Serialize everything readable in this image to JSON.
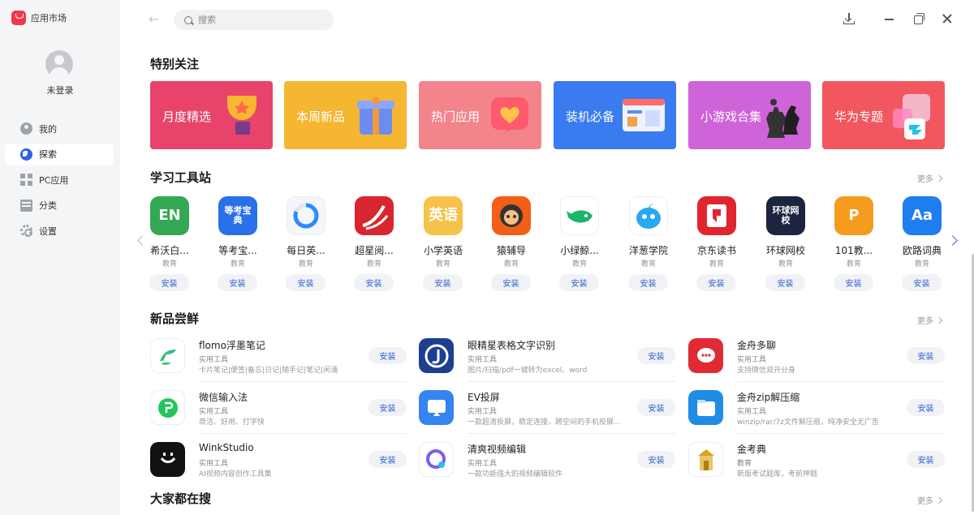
{
  "app": {
    "name": "应用市场"
  },
  "user": {
    "login_text": "未登录"
  },
  "nav": [
    {
      "label": "我的",
      "icon": "user-icon"
    },
    {
      "label": "探索",
      "icon": "globe-icon",
      "active": true
    },
    {
      "label": "PC应用",
      "icon": "grid-icon"
    },
    {
      "label": "分类",
      "icon": "category-icon"
    },
    {
      "label": "设置",
      "icon": "gear-icon"
    }
  ],
  "search": {
    "placeholder": "搜索",
    "value": ""
  },
  "sections": {
    "featured": {
      "title": "特别关注"
    },
    "study": {
      "title": "学习工具站",
      "more": "更多"
    },
    "new": {
      "title": "新品尝鲜",
      "more": "更多"
    },
    "popular": {
      "title": "大家都在搜",
      "more": "更多"
    }
  },
  "banners": [
    {
      "label": "月度精选",
      "color": "#e8436a"
    },
    {
      "label": "本周新品",
      "color": "#f5b731"
    },
    {
      "label": "热门应用",
      "color": "#f3848c"
    },
    {
      "label": "装机必备",
      "color": "#3a7bf0"
    },
    {
      "label": "小游戏合集",
      "color": "#cf64d8"
    },
    {
      "label": "华为专题",
      "color": "#f2575f"
    }
  ],
  "study_apps": [
    {
      "name": "希沃白...",
      "category": "教育",
      "install": "安装",
      "icon_text": "EN",
      "color": "#35a853"
    },
    {
      "name": "等考宝...",
      "category": "教育",
      "install": "安装",
      "icon_text": "等考宝典",
      "color": "#2a70e8"
    },
    {
      "name": "每日英...",
      "category": "教育",
      "install": "安装",
      "icon_text": "",
      "color": "#f4f6f9"
    },
    {
      "name": "超星阅...",
      "category": "教育",
      "install": "安装",
      "icon_text": "",
      "color": "#d9262e"
    },
    {
      "name": "小学英语",
      "category": "教育",
      "install": "安装",
      "icon_text": "英语",
      "color": "#f6c24a"
    },
    {
      "name": "猿辅导",
      "category": "教育",
      "install": "安装",
      "icon_text": "",
      "color": "#f35f16"
    },
    {
      "name": "小绿鲸...",
      "category": "教育",
      "install": "安装",
      "icon_text": "",
      "color": "#ffffff"
    },
    {
      "name": "洋葱学院",
      "category": "教育",
      "install": "安装",
      "icon_text": "",
      "color": "#ffffff"
    },
    {
      "name": "京东读书",
      "category": "教育",
      "install": "安装",
      "icon_text": "",
      "color": "#e1252e"
    },
    {
      "name": "环球网校",
      "category": "教育",
      "install": "安装",
      "icon_text": "环球网校",
      "color": "#1c2440"
    },
    {
      "name": "101教...",
      "category": "教育",
      "install": "安装",
      "icon_text": "P",
      "color": "#f59c1f"
    },
    {
      "name": "欧路词典",
      "category": "教育",
      "install": "安装",
      "icon_text": "Aa",
      "color": "#1e7ef0"
    }
  ],
  "new_apps": [
    {
      "name": "flomo浮墨笔记",
      "category": "实用工具",
      "desc": "卡片笔记|便签|备忘|日记|随手记|笔记|闲涌",
      "install": "安装",
      "color": "#ffffff",
      "accent": "#30c27a"
    },
    {
      "name": "眼精星表格文字识别",
      "category": "实用工具",
      "desc": "图片/扫描/pdf一键转为excel、word",
      "install": "安装",
      "color": "#1d3f8f",
      "accent": "#ffffff"
    },
    {
      "name": "金舟多聊",
      "category": "实用工具",
      "desc": "支持微信双开分身",
      "install": "安装",
      "color": "#e02b35",
      "accent": "#ffffff"
    },
    {
      "name": "微信输入法",
      "category": "实用工具",
      "desc": "简洁、好用、打字快",
      "install": "安装",
      "color": "#ffffff",
      "accent": "#22c55e"
    },
    {
      "name": "EV投屏",
      "category": "实用工具",
      "desc": "一款超清投屏，稳定连接，跨空间的手机投屏...",
      "install": "安装",
      "color": "#3584f0",
      "accent": "#ffffff"
    },
    {
      "name": "金舟zip解压缩",
      "category": "实用工具",
      "desc": "winzip/rar/7z文件解压缩，纯净安全无广告",
      "install": "安装",
      "color": "#1f8ce6",
      "accent": "#ffffff"
    },
    {
      "name": "WinkStudio",
      "category": "实用工具",
      "desc": "AI视频内容创作工具集",
      "install": "安装",
      "color": "#111111",
      "accent": "#ffffff"
    },
    {
      "name": "清爽视频编辑",
      "category": "实用工具",
      "desc": "一款功能强大的视频编辑软件",
      "install": "安装",
      "color": "#ffffff",
      "accent": "#7b5cf0"
    },
    {
      "name": "金考典",
      "category": "教育",
      "desc": "新版考试题库，考前押题",
      "install": "安装",
      "color": "#ffffff",
      "accent": "#d9a521"
    }
  ]
}
